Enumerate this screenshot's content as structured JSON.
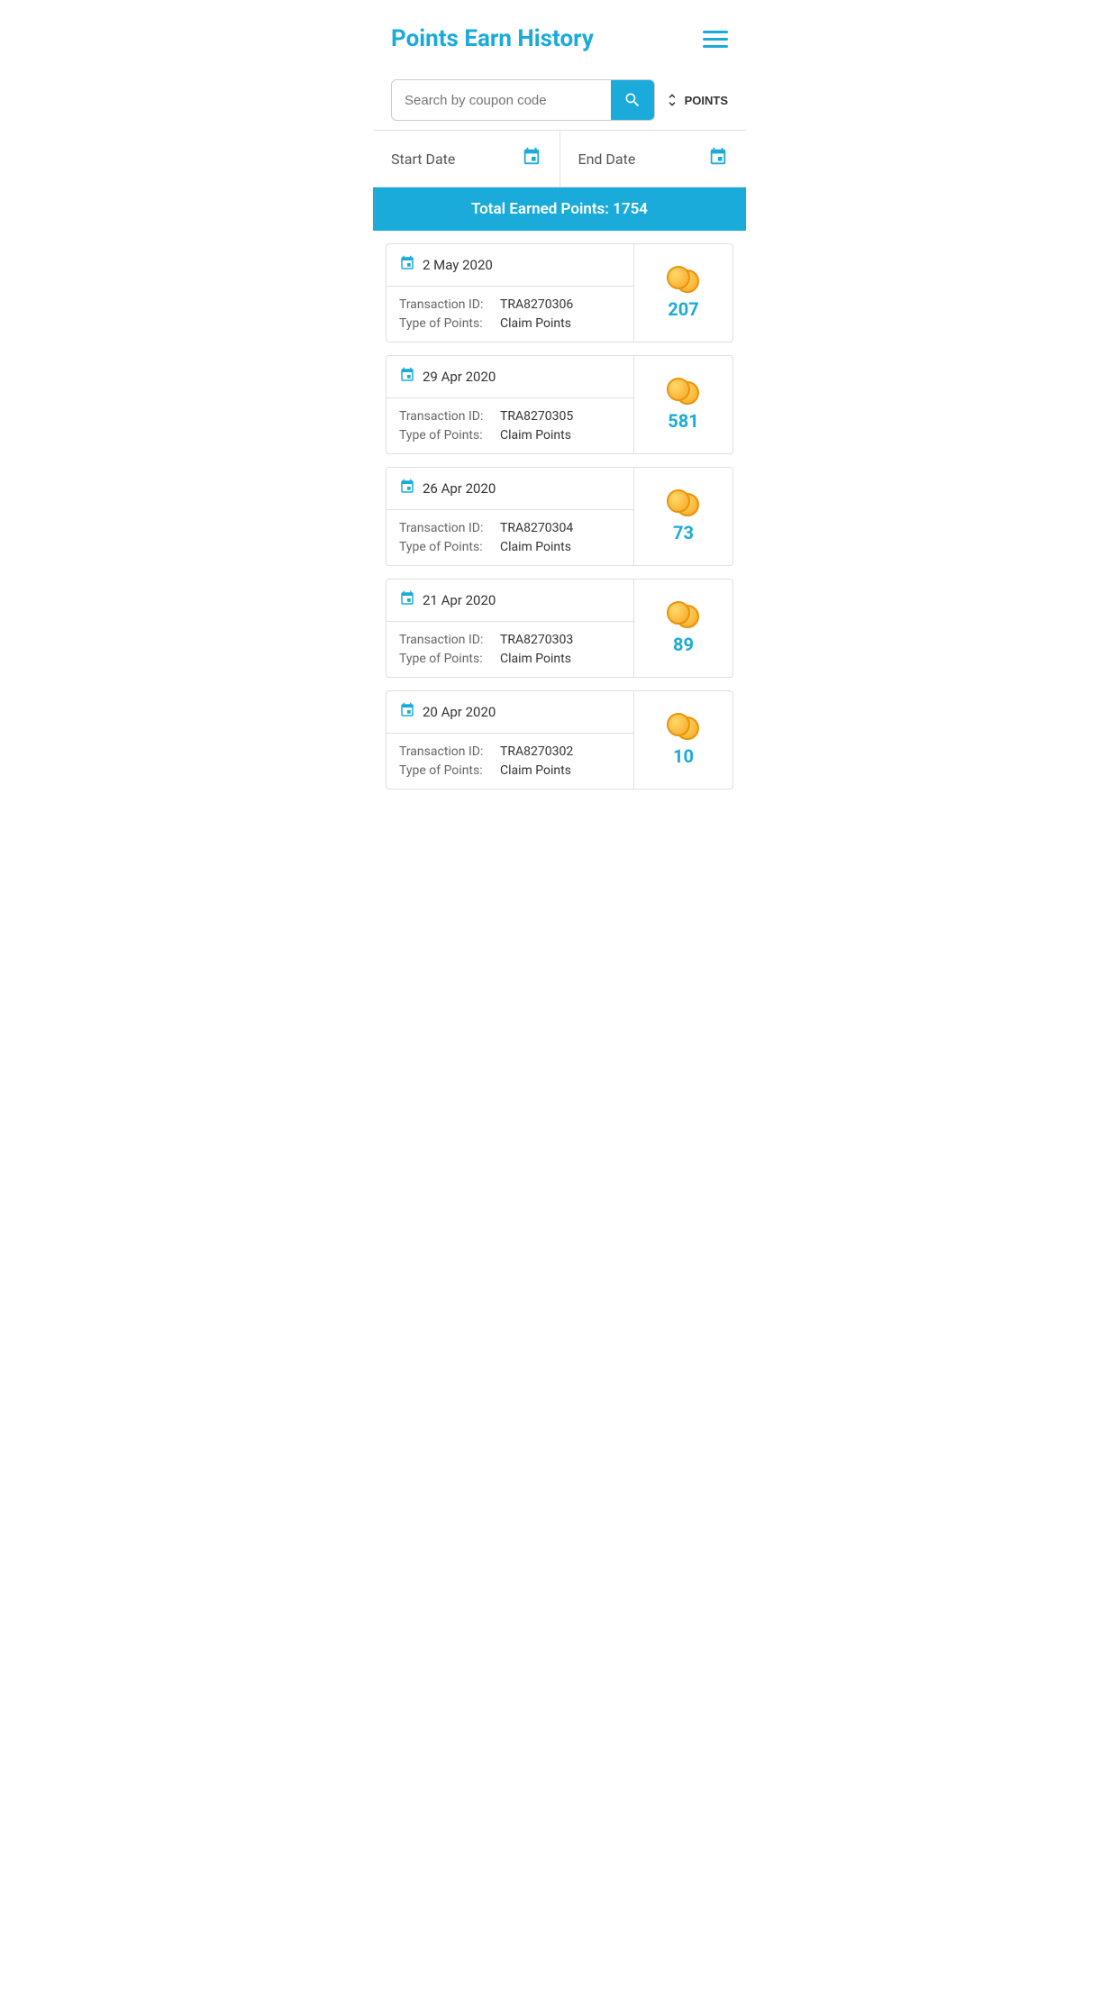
{
  "header": {
    "title": "Points Earn History",
    "menu_label": "menu"
  },
  "search": {
    "placeholder": "Search by coupon code",
    "sort_label": "POINTS"
  },
  "date_filter": {
    "start_label": "Start Date",
    "end_label": "End Date"
  },
  "total_bar": {
    "text": "Total Earned Points: 1754"
  },
  "transactions": [
    {
      "date": "2 May 2020",
      "transaction_id_label": "Transaction ID:",
      "transaction_id_value": "TRA8270306",
      "type_label": "Type of Points:",
      "type_value": "Claim Points",
      "points": "207"
    },
    {
      "date": "29 Apr 2020",
      "transaction_id_label": "Transaction ID:",
      "transaction_id_value": "TRA8270305",
      "type_label": "Type of Points:",
      "type_value": "Claim Points",
      "points": "581"
    },
    {
      "date": "26 Apr 2020",
      "transaction_id_label": "Transaction ID:",
      "transaction_id_value": "TRA8270304",
      "type_label": "Type of Points:",
      "type_value": "Claim Points",
      "points": "73"
    },
    {
      "date": "21 Apr 2020",
      "transaction_id_label": "Transaction ID:",
      "transaction_id_value": "TRA8270303",
      "type_label": "Type of Points:",
      "type_value": "Claim Points",
      "points": "89"
    },
    {
      "date": "20 Apr 2020",
      "transaction_id_label": "Transaction ID:",
      "transaction_id_value": "TRA8270302",
      "type_label": "Type of Points:",
      "type_value": "Claim Points",
      "points": "10"
    }
  ]
}
